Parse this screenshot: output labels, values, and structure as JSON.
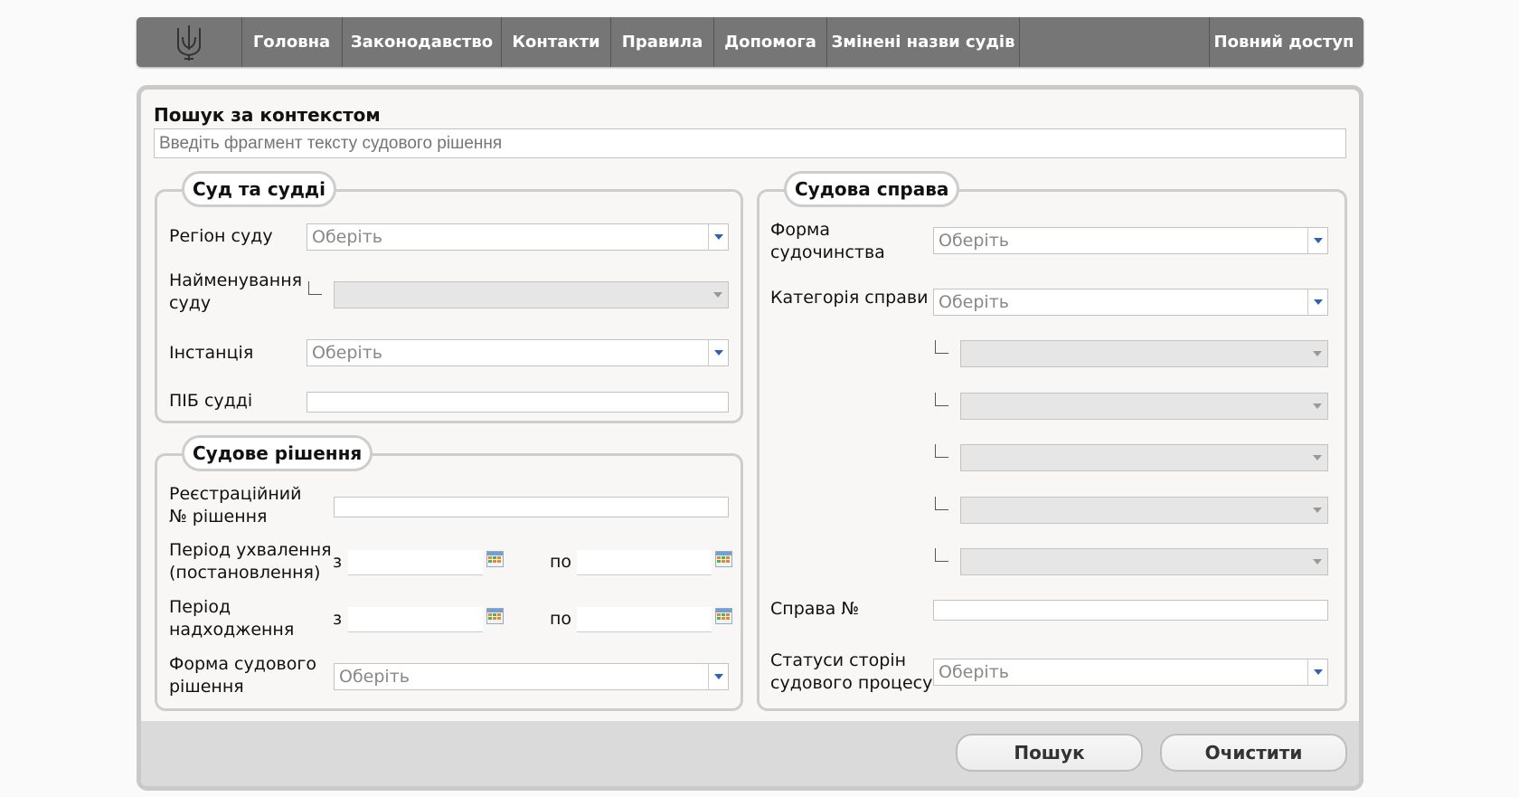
{
  "nav": {
    "items": [
      "Головна",
      "Законодавство",
      "Контакти",
      "Правила",
      "Допомога",
      "Змінені назви судів"
    ],
    "right_item": "Повний доступ"
  },
  "context_search": {
    "label": "Пошук за контекстом",
    "placeholder": "Введіть фрагмент тексту судового рішення"
  },
  "court_section": {
    "legend": "Суд та судді",
    "region_label": "Регіон суду",
    "region_value": "Оберіть",
    "court_name_label_1": "Найменування",
    "court_name_label_2": "суду",
    "instance_label": "Інстанція",
    "instance_value": "Оберіть",
    "judge_label": "ПІБ судді",
    "judge_value": ""
  },
  "decision_section": {
    "legend": "Судове рішення",
    "reg_no_label_1": "Реєстраційний",
    "reg_no_label_2": "№ рішення",
    "adopt_period_label_1": "Період ухвалення",
    "adopt_period_label_2": "(постановлення)",
    "receipt_period_label_1": "Період",
    "receipt_period_label_2": "надходження",
    "from_label": "з",
    "to_label": "по",
    "form_label_1": "Форма судового",
    "form_label_2": "рішення",
    "form_value": "Оберіть"
  },
  "case_section": {
    "legend": "Судова справа",
    "proceeding_label_1": "Форма",
    "proceeding_label_2": "судочинства",
    "proceeding_value": "Оберіть",
    "category_label": "Категорія справи",
    "category_value": "Оберіть",
    "case_no_label": "Справа №",
    "case_no_value": "",
    "party_status_label_1": "Статуси сторін",
    "party_status_label_2": "судового процесу",
    "party_status_value": "Оберіть"
  },
  "buttons": {
    "search": "Пошук",
    "clear": "Очистити"
  },
  "colors": {
    "nav_bg": "#767676",
    "panel_border": "#c9c9c9",
    "footer_bg": "#dadada",
    "select_arrow": "#3060b8"
  }
}
